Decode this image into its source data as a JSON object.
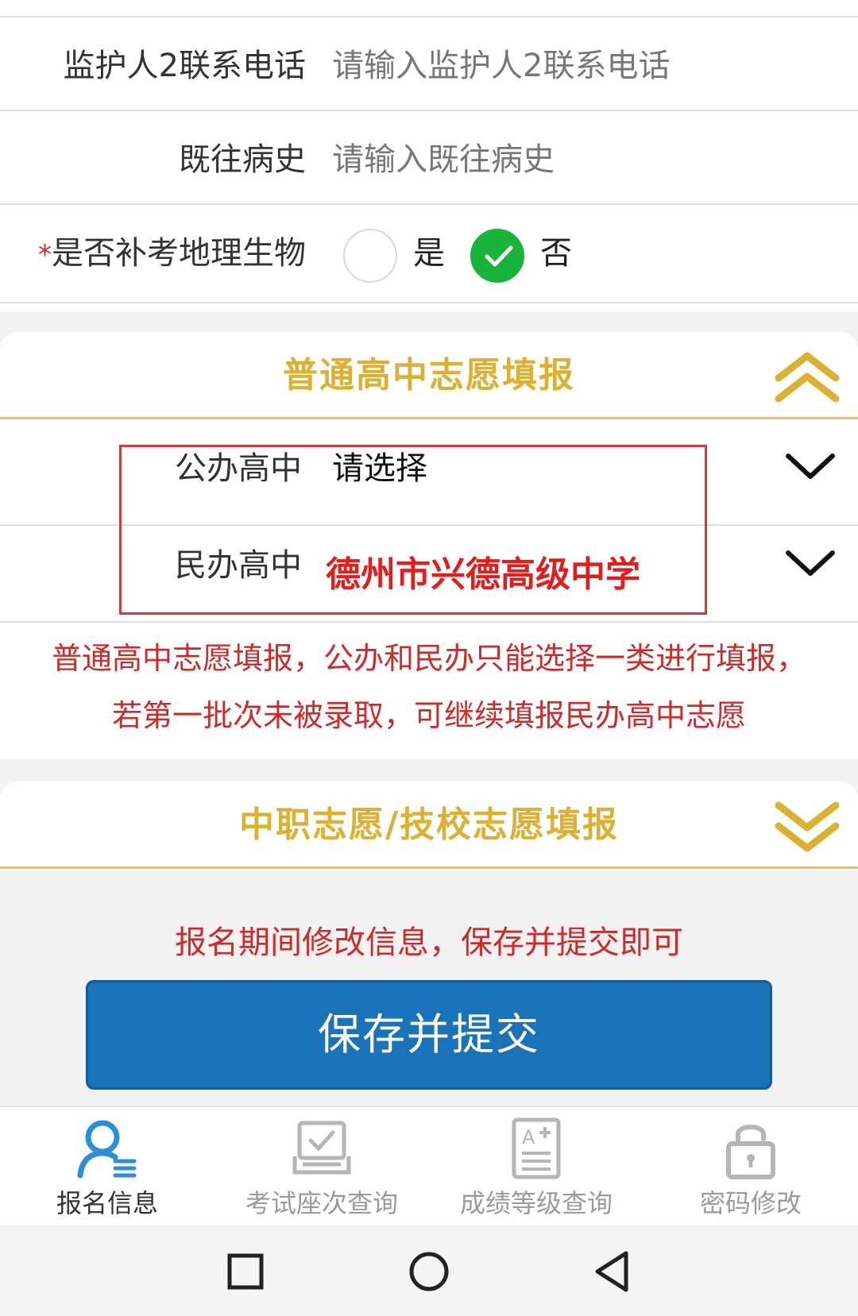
{
  "form": {
    "guardian2_phone": {
      "label": "监护人2联系电话",
      "placeholder": "请输入监护人2联系电话"
    },
    "medical_history": {
      "label": "既往病史",
      "placeholder": "请输入既往病史"
    },
    "makeup_exam": {
      "required_mark": "*",
      "label": "是否补考地理生物",
      "options": [
        {
          "label": "是",
          "selected": false
        },
        {
          "label": "否",
          "selected": true
        }
      ]
    }
  },
  "general_hs_section": {
    "title": "普通高中志愿填报",
    "expanded": true,
    "rows": [
      {
        "label": "公办高中",
        "value": "请选择"
      },
      {
        "label": "民办高中",
        "value": "德州市兴德高级中学"
      }
    ],
    "notice_line1": "普通高中志愿填报，公办和民办只能选择一类进行填报，",
    "notice_line2": "若第一批次未被录取，可继续填报民办高中志愿"
  },
  "vocational_section": {
    "title": "中职志愿/技校志愿填报",
    "expanded": false
  },
  "footer_notice": "报名期间修改信息，保存并提交即可",
  "save_button": "保存并提交",
  "tabs": [
    {
      "label": "报名信息",
      "icon": "user-info-icon",
      "active": true
    },
    {
      "label": "考试座次查询",
      "icon": "exam-seat-icon",
      "active": false
    },
    {
      "label": "成绩等级查询",
      "icon": "grade-report-icon",
      "active": false
    },
    {
      "label": "密码修改",
      "icon": "lock-icon",
      "active": false
    }
  ],
  "colors": {
    "accent_gold": "#dcb030",
    "alert_red": "#e21d1d",
    "button_blue": "#1a73b8",
    "radio_green": "#19b43c",
    "tab_active_blue": "#2a8fd6"
  }
}
